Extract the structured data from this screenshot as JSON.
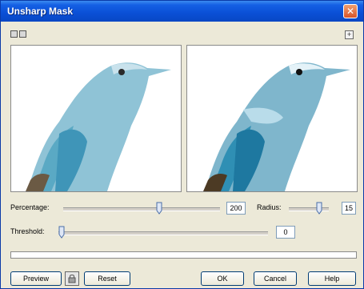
{
  "window": {
    "title": "Unsharp Mask",
    "close_glyph": "✕",
    "expand_glyph": "+"
  },
  "controls": {
    "percentage_label": "Percentage:",
    "percentage_value": "200",
    "radius_label": "Radius:",
    "radius_value": "15",
    "threshold_label": "Threshold:",
    "threshold_value": "0"
  },
  "buttons": {
    "preview": "Preview",
    "reset": "Reset",
    "ok": "OK",
    "cancel": "Cancel",
    "help": "Help"
  },
  "icons": {
    "toolbar_left": "dual-view-icon",
    "toolbar_right": "single-view-icon",
    "expand": "plus-icon",
    "lock": "lock-icon"
  },
  "colors": {
    "title_bar": "#0a4fd6",
    "close_button": "#d8542a",
    "dialog_background": "#ece9d8"
  }
}
